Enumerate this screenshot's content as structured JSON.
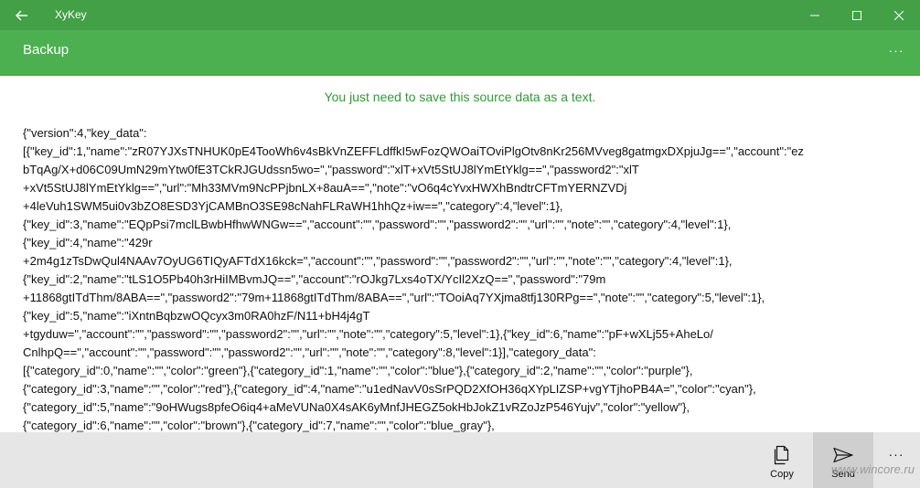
{
  "window": {
    "title": "XyKey"
  },
  "header": {
    "title": "Backup",
    "more_label": "···"
  },
  "content": {
    "hint": "You just need to save this source data as a text.",
    "source_lines": [
      "{\"version\":4,\"key_data\":",
      "[{\"key_id\":1,\"name\":\"zR07YJXsTNHUK0pE4TooWh6v4sBkVnZEFFLdffkI5wFozQWOaiTOviPlgOtv8nKr256MVveg8gatmgxDXpjuJg==\",\"account\":\"ez",
      "bTqAg/X+d06C09UmN29mYtw0fE3TCkRJGUdssn5wo=\",\"password\":\"xlT+xVt5StUJ8lYmEtYklg==\",\"password2\":\"xlT",
      "+xVt5StUJ8lYmEtYklg==\",\"url\":\"Mh33MVm9NcPPjbnLX+8auA==\",\"note\":\"vO6q4cYvxHWXhBndtrCFTmYERNZVDj",
      "+4leVuh1SWM5ui0v3bZO8ESD3YjCAMBnO3SE98cNahFLRaWH1hhQz+iw==\",\"category\":4,\"level\":1},",
      "{\"key_id\":3,\"name\":\"EQpPsi7mclLBwbHfhwWNGw==\",\"account\":\"\",\"password\":\"\",\"password2\":\"\",\"url\":\"\",\"note\":\"\",\"category\":4,\"level\":1},",
      "{\"key_id\":4,\"name\":\"429r",
      "+2m4g1zTsDwQul4NAAv7OyUG6TIQyAFTdX16kck=\",\"account\":\"\",\"password\":\"\",\"password2\":\"\",\"url\":\"\",\"note\":\"\",\"category\":4,\"level\":1},",
      "{\"key_id\":2,\"name\":\"tLS1O5Pb40h3rHiIMBvmJQ==\",\"account\":\"rOJkg7Lxs4oTX/YcIl2XzQ==\",\"password\":\"79m",
      "+11868gtITdThm/8ABA==\",\"password2\":\"79m+11868gtITdThm/8ABA==\",\"url\":\"TOoiAq7YXjma8tfj130RPg==\",\"note\":\"\",\"category\":5,\"level\":1},",
      "{\"key_id\":5,\"name\":\"iXntnBqbzwOQcyx3m0RA0hzF/N11+bH4j4gT",
      "+tgyduw=\",\"account\":\"\",\"password\":\"\",\"password2\":\"\",\"url\":\"\",\"note\":\"\",\"category\":5,\"level\":1},{\"key_id\":6,\"name\":\"pF+wXLj55+AheLo/",
      "CnlhpQ==\",\"account\":\"\",\"password\":\"\",\"password2\":\"\",\"url\":\"\",\"note\":\"\",\"category\":8,\"level\":1}],\"category_data\":",
      "[{\"category_id\":0,\"name\":\"\",\"color\":\"green\"},{\"category_id\":1,\"name\":\"\",\"color\":\"blue\"},{\"category_id\":2,\"name\":\"\",\"color\":\"purple\"},",
      "{\"category_id\":3,\"name\":\"\",\"color\":\"red\"},{\"category_id\":4,\"name\":\"u1edNavV0sSrPQD2XfOH36qXYpLIZSP+vgYTjhoPB4A=\",\"color\":\"cyan\"},",
      "{\"category_id\":5,\"name\":\"9oHWugs8pfeO6iq4+aMeVUNa0X4sAK6yMnfJHEGZ5okHbJokZ1vRZoJzP546Yujv\",\"color\":\"yellow\"},",
      "{\"category_id\":6,\"name\":\"\",\"color\":\"brown\"},{\"category_id\":7,\"name\":\"\",\"color\":\"blue_gray\"},"
    ]
  },
  "commands": {
    "copy_label": "Copy",
    "send_label": "Send",
    "more_label": "···"
  },
  "watermark": "www.wincore.ru",
  "colors": {
    "titlebar": "#43a047",
    "appbar": "#4caf50",
    "hint_text": "#2e9c32",
    "bottombar": "#e6e6e6"
  },
  "icons": {
    "back": "back-arrow-icon",
    "minimize": "minimize-icon",
    "maximize": "maximize-icon",
    "close": "close-icon",
    "copy": "copy-icon",
    "send": "send-icon"
  }
}
